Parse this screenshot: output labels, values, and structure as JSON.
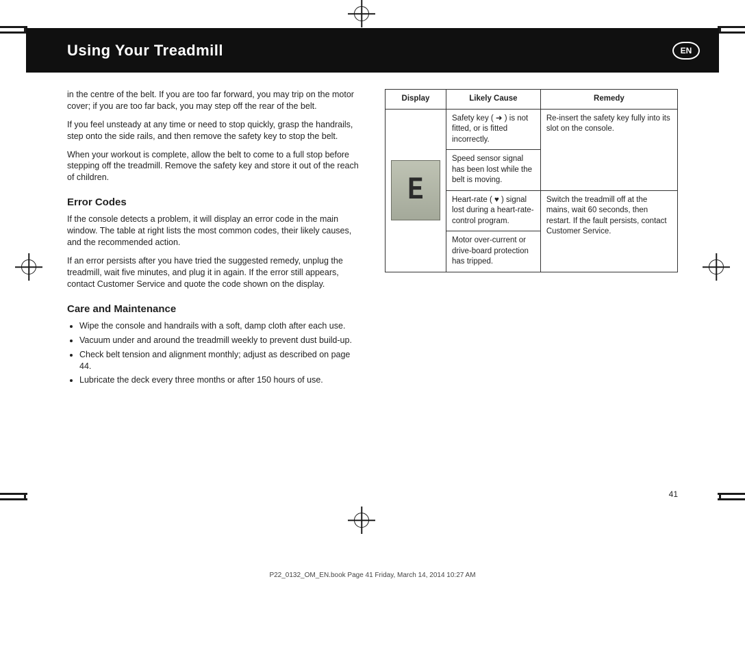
{
  "header": {
    "title": "Using Your Treadmill",
    "language_badge": "EN"
  },
  "left_column": {
    "paragraphs": [
      "in the centre of the belt. If you are too far forward, you may trip on the motor cover; if you are too far back, you may step off the rear of the belt.",
      "If you feel unsteady at any time or need to stop quickly, grasp the handrails, step onto the side rails, and then remove the safety key to stop the belt.",
      "When your workout is complete, allow the belt to come to a full stop before stepping off the treadmill. Remove the safety key and store it out of the reach of children."
    ],
    "error_heading": "Error Codes",
    "error_intro": "If the console detects a problem, it will display an error code in the main window. The table at right lists the most common codes, their likely causes, and the recommended action.",
    "service_note": "If an error persists after you have tried the suggested remedy, unplug the treadmill, wait five minutes, and plug it in again. If the error still appears, contact Customer Service and quote the code shown on the display."
  },
  "table": {
    "headers": [
      "Display",
      "Likely Cause",
      "Remedy"
    ],
    "display_cell_label": "E",
    "rows": [
      {
        "cause": "Safety key ( ➜ ) is not fitted, or is fitted incorrectly.",
        "remedy": "Re-insert the safety key fully into its slot on the console."
      },
      {
        "cause": "Speed sensor signal has been lost while the belt is moving.",
        "remedy_span_start": true,
        "remedy": ""
      },
      {
        "cause": "Heart-rate ( ♥ ) signal lost during a heart-rate-control program.",
        "remedy": "Switch the treadmill off at the mains, wait 60 seconds, then restart. If the fault persists, contact Customer Service."
      },
      {
        "cause": "Motor over-current or drive-board protection has tripped.",
        "remedy": ""
      }
    ]
  },
  "maintenance": {
    "heading": "Care and Maintenance",
    "items": [
      "Wipe the console and handrails with a soft, damp cloth after each use.",
      "Vacuum under and around the treadmill weekly to prevent dust build-up.",
      "Check belt tension and alignment monthly; adjust as described on page 44.",
      "Lubricate the deck every three months or after 150 hours of use."
    ]
  },
  "page_number": "41",
  "footer_note": "P22_0132_OM_EN.book  Page 41  Friday, March 14, 2014  10:27 AM"
}
